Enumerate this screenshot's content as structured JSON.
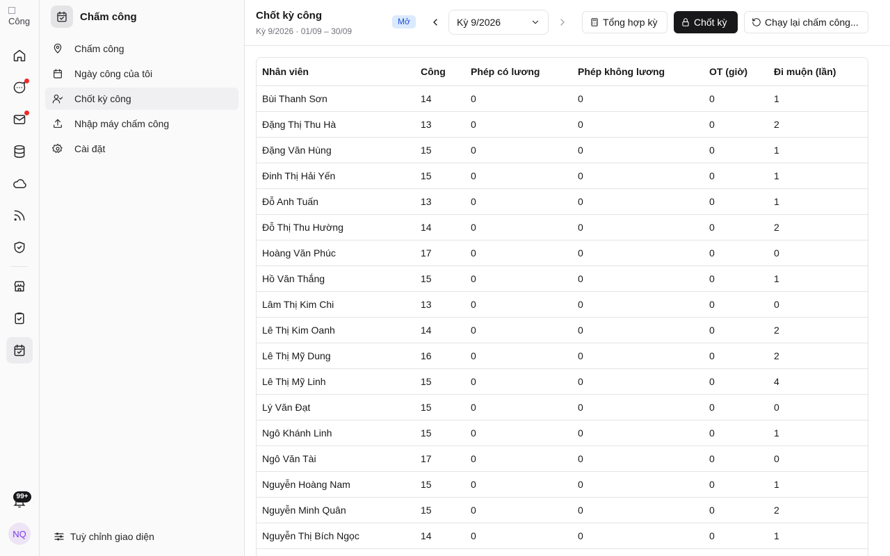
{
  "rail": {
    "logo_text": "Công",
    "notifications_badge": "99+",
    "avatar_initials": "NQ"
  },
  "sidebar": {
    "title": "Chấm công",
    "items": [
      {
        "label": "Chấm công",
        "icon": "map-pin-icon"
      },
      {
        "label": "Ngày công của tôi",
        "icon": "calendar-days-icon"
      },
      {
        "label": "Chốt kỳ công",
        "icon": "user-check-icon"
      },
      {
        "label": "Nhập máy chấm công",
        "icon": "upload-icon"
      },
      {
        "label": "Cài đặt",
        "icon": "gear-icon"
      }
    ],
    "footer_label": "Tuỳ chỉnh giao diện"
  },
  "header": {
    "title": "Chốt kỳ công",
    "subtitle": "Kỳ 9/2026 · 01/09 – 30/09",
    "status": "Mở",
    "period_value": "Kỳ 9/2026",
    "summary_label": "Tổng hợp kỳ",
    "close_label": "Chốt kỳ",
    "rerun_label": "Chạy lại chấm công..."
  },
  "table": {
    "columns": [
      "Nhân viên",
      "Công",
      "Phép có lương",
      "Phép không lương",
      "OT (giờ)",
      "Đi muộn (lần)"
    ],
    "rows": [
      [
        "Bùi Thanh Sơn",
        "14",
        "0",
        "0",
        "0",
        "1"
      ],
      [
        "Đặng Thị Thu Hà",
        "13",
        "0",
        "0",
        "0",
        "2"
      ],
      [
        "Đặng Văn Hùng",
        "15",
        "0",
        "0",
        "0",
        "1"
      ],
      [
        "Đinh Thị Hải Yến",
        "15",
        "0",
        "0",
        "0",
        "1"
      ],
      [
        "Đỗ Anh Tuấn",
        "13",
        "0",
        "0",
        "0",
        "1"
      ],
      [
        "Đỗ Thị Thu Hường",
        "14",
        "0",
        "0",
        "0",
        "2"
      ],
      [
        "Hoàng Văn Phúc",
        "17",
        "0",
        "0",
        "0",
        "0"
      ],
      [
        "Hồ Văn Thắng",
        "15",
        "0",
        "0",
        "0",
        "1"
      ],
      [
        "Lâm Thị Kim Chi",
        "13",
        "0",
        "0",
        "0",
        "0"
      ],
      [
        "Lê Thị Kim Oanh",
        "14",
        "0",
        "0",
        "0",
        "2"
      ],
      [
        "Lê Thị Mỹ Dung",
        "16",
        "0",
        "0",
        "0",
        "2"
      ],
      [
        "Lê Thị Mỹ Linh",
        "15",
        "0",
        "0",
        "0",
        "4"
      ],
      [
        "Lý Văn Đạt",
        "15",
        "0",
        "0",
        "0",
        "0"
      ],
      [
        "Ngô Khánh Linh",
        "15",
        "0",
        "0",
        "0",
        "1"
      ],
      [
        "Ngô Văn Tài",
        "17",
        "0",
        "0",
        "0",
        "0"
      ],
      [
        "Nguyễn Hoàng Nam",
        "15",
        "0",
        "0",
        "0",
        "1"
      ],
      [
        "Nguyễn Minh Quân",
        "15",
        "0",
        "0",
        "0",
        "2"
      ],
      [
        "Nguyễn Thị Bích Ngọc",
        "14",
        "0",
        "0",
        "0",
        "1"
      ]
    ]
  }
}
